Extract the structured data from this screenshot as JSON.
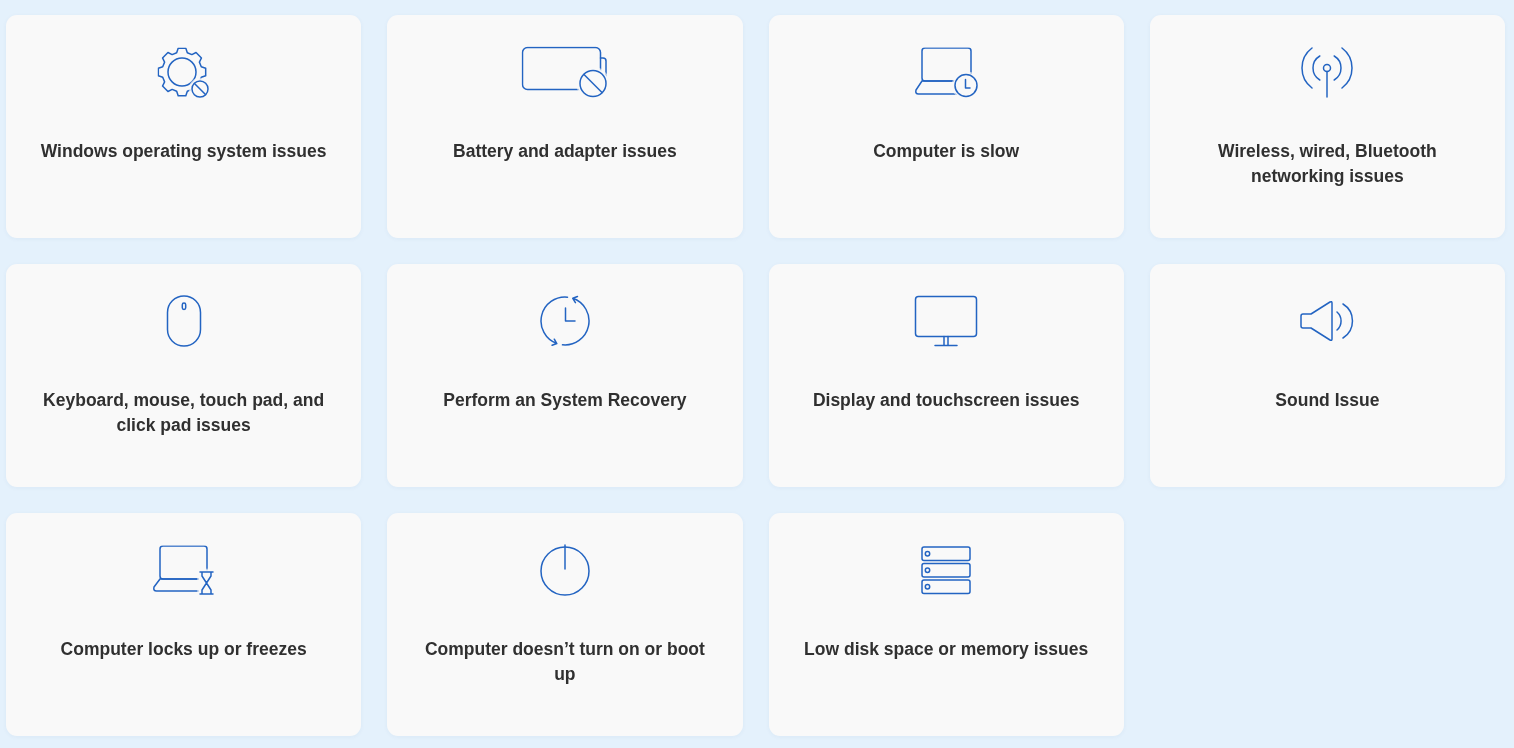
{
  "cards": [
    {
      "kind": "system",
      "label": "Windows operating system issues"
    },
    {
      "kind": "battery",
      "label": "Battery and adapter issues"
    },
    {
      "kind": "performance",
      "label": "Computer is slow"
    },
    {
      "kind": "network",
      "label": "Wireless, wired, Bluetooth networking issues"
    },
    {
      "kind": "input",
      "label": "Keyboard, mouse, touch pad, and click pad issues"
    },
    {
      "kind": "recovery",
      "label": "Perform an System Recovery"
    },
    {
      "kind": "display",
      "label": "Display and touchscreen issues"
    },
    {
      "kind": "sound",
      "label": "Sound Issue"
    },
    {
      "kind": "freeze",
      "label": "Computer locks up or freezes"
    },
    {
      "kind": "power",
      "label": "Computer doesn’t turn on or boot up"
    },
    {
      "kind": "storage",
      "label": "Low disk space or memory issues"
    }
  ]
}
